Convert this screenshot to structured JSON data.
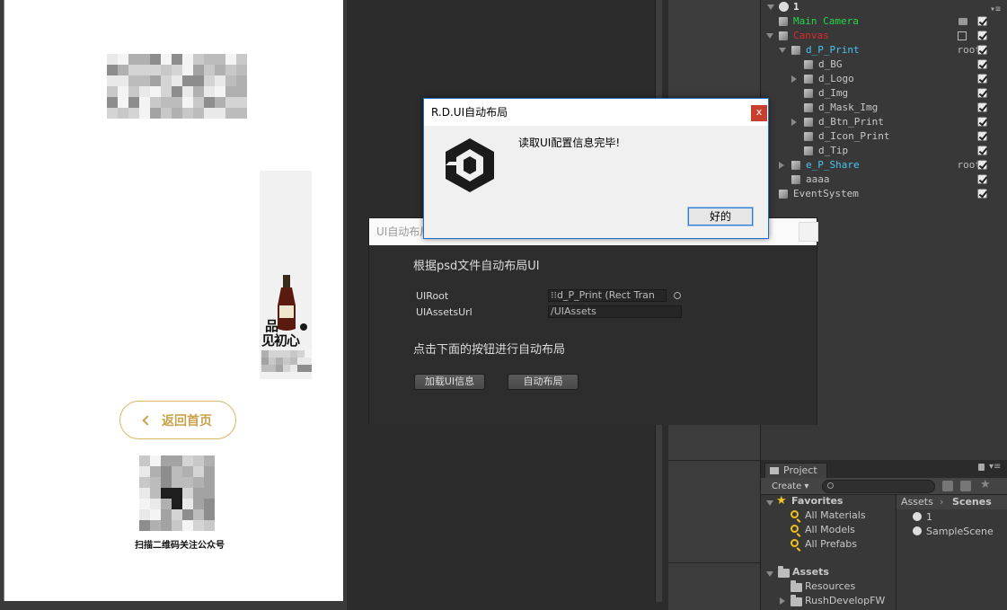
{
  "game_view": {
    "back_button_label": "返回首页",
    "back_icon": "chevron-left-icon",
    "qr_caption": "扫描二维码关注公众号",
    "bottle_text_1": "品",
    "bottle_text_2": "见初心"
  },
  "hierarchy": {
    "scene_name": "1",
    "items": [
      {
        "label": "Main Camera",
        "color": "#25d84a",
        "checked": true
      },
      {
        "label": "Canvas",
        "color": "#e0282a",
        "checked": true
      },
      {
        "label": "d_P_Print",
        "color": "#49c4f0",
        "tag": "root",
        "checked": true
      },
      {
        "label": "d_BG",
        "color": "#c8c8c8",
        "checked": true
      },
      {
        "label": "d_Logo",
        "color": "#c8c8c8",
        "checked": true
      },
      {
        "label": "d_Img",
        "color": "#c8c8c8",
        "checked": true
      },
      {
        "label": "d_Mask_Img",
        "color": "#c8c8c8",
        "checked": true
      },
      {
        "label": "d_Btn_Print",
        "color": "#c8c8c8",
        "checked": true
      },
      {
        "label": "d_Icon_Print",
        "color": "#c8c8c8",
        "checked": true
      },
      {
        "label": "d_Tip",
        "color": "#c8c8c8",
        "checked": true
      },
      {
        "label": "e_P_Share",
        "color": "#49c4f0",
        "tag": "root",
        "checked": true
      },
      {
        "label": "aaaa",
        "color": "#c8c8c8",
        "checked": true
      },
      {
        "label": "EventSystem",
        "color": "#c8c8c8",
        "checked": true
      }
    ]
  },
  "project": {
    "tab_label": "Project",
    "create_label": "Create ▾",
    "favorites_label": "Favorites",
    "favorites": [
      "All Materials",
      "All Models",
      "All Prefabs"
    ],
    "assets_label": "Assets",
    "asset_folders": [
      "Resources",
      "RushDevelopFW"
    ],
    "breadcrumb_root": "Assets",
    "breadcrumb_current": "Scenes",
    "scene_files": [
      "1",
      "SampleScene"
    ]
  },
  "layout_window": {
    "title": "UI自动布局",
    "heading": "根据psd文件自动布局UI",
    "uiroot_label": "UIRoot",
    "uiroot_value": "⁝⁝d_P_Print (Rect Tran",
    "assets_url_label": "UIAssetsUrl",
    "assets_url_value": "/UIAssets",
    "instruction": "点击下面的按钮进行自动布局",
    "load_button": "加载UI信息",
    "auto_button": "自动布局"
  },
  "message_box": {
    "title": "R.D.UI自动布局",
    "message": "读取UI配置信息完毕!",
    "ok_label": "好的",
    "close_label": "x"
  }
}
